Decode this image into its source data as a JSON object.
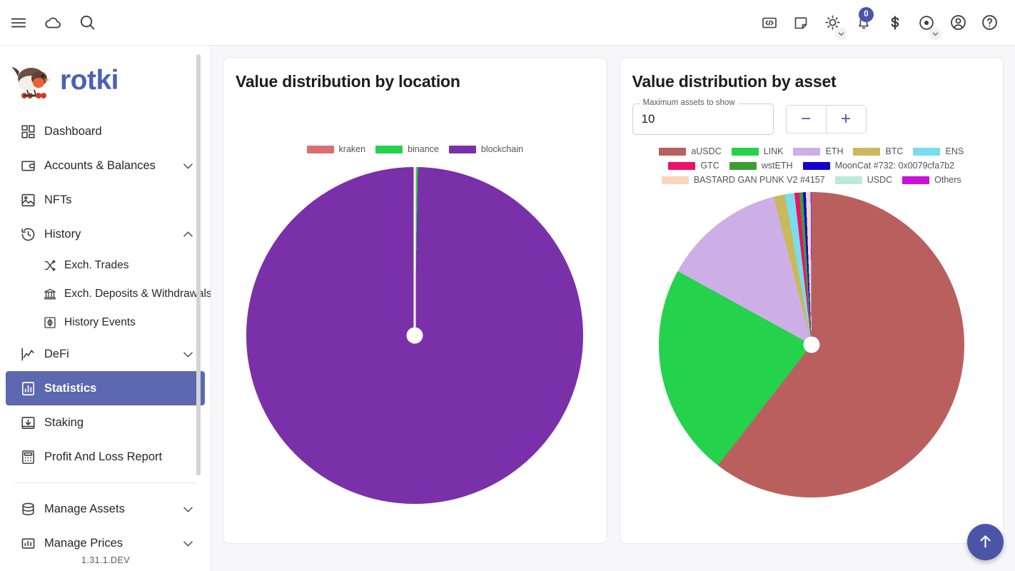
{
  "app": {
    "brand_name": "rotki",
    "version": "1.31.1.DEV"
  },
  "topbar": {
    "left_icons": [
      {
        "name": "menu-icon",
        "label": "Menu"
      },
      {
        "name": "cloud-icon",
        "label": "Backup"
      },
      {
        "name": "search-icon",
        "label": "Search"
      }
    ],
    "right_icons": [
      {
        "name": "code-icon",
        "label": "Developer"
      },
      {
        "name": "note-icon",
        "label": "Notes"
      },
      {
        "name": "sun-icon",
        "label": "Theme"
      },
      {
        "name": "bell-icon",
        "label": "Notifications"
      },
      {
        "name": "dollar-icon",
        "label": "Currency"
      },
      {
        "name": "eye-icon",
        "label": "Privacy mode"
      },
      {
        "name": "account-circle-icon",
        "label": "Account"
      },
      {
        "name": "help-circle-icon",
        "label": "Help"
      }
    ],
    "notification_count": "0"
  },
  "sidebar": {
    "items": [
      {
        "label": "Dashboard",
        "icon": "dashboard-icon",
        "expandable": false,
        "active": false
      },
      {
        "label": "Accounts & Balances",
        "icon": "wallet-icon",
        "expandable": true,
        "expanded": false,
        "active": false
      },
      {
        "label": "NFTs",
        "icon": "image-icon",
        "expandable": false,
        "active": false
      },
      {
        "label": "History",
        "icon": "history-icon",
        "expandable": true,
        "expanded": true,
        "active": false
      },
      {
        "label": "DeFi",
        "icon": "line-chart-icon",
        "expandable": true,
        "expanded": false,
        "active": false
      },
      {
        "label": "Statistics",
        "icon": "bar-chart-doc-icon",
        "expandable": false,
        "active": true
      },
      {
        "label": "Staking",
        "icon": "inbox-down-icon",
        "expandable": false,
        "active": false
      },
      {
        "label": "Profit And Loss Report",
        "icon": "calculator-icon",
        "expandable": false,
        "active": false
      },
      {
        "label": "Manage Assets",
        "icon": "database-icon",
        "expandable": true,
        "expanded": false,
        "active": false
      },
      {
        "label": "Manage Prices",
        "icon": "price-tag-chart-icon",
        "expandable": true,
        "expanded": false,
        "active": false
      }
    ],
    "history_subitems": [
      {
        "label": "Exch. Trades",
        "icon": "shuffle-icon"
      },
      {
        "label": "Exch. Deposits & Withdrawals",
        "icon": "bank-icon"
      },
      {
        "label": "History Events",
        "icon": "swap-vertical-icon"
      }
    ]
  },
  "chart_data": [
    {
      "type": "pie",
      "title": "Value distribution by location",
      "categories": [
        "kraken",
        "binance",
        "blockchain"
      ],
      "values": [
        0.15,
        0.15,
        99.7
      ],
      "colors": [
        "#d9706f",
        "#24d24c",
        "#7a30a8"
      ],
      "legend_position": "top",
      "unit": "percent"
    },
    {
      "type": "pie",
      "title": "Value distribution by asset",
      "categories": [
        "aUSDC",
        "LINK",
        "ETH",
        "BTC",
        "ENS",
        "GTC",
        "wstETH",
        "MoonCat #732: 0x0079cfa7b2",
        "BASTARD GAN PUNK V2 #4157",
        "USDC",
        "Others"
      ],
      "values": [
        60.5,
        22.5,
        13.0,
        1.2,
        1.0,
        0.5,
        0.4,
        0.3,
        0.3,
        0.2,
        0.1
      ],
      "colors": [
        "#b9605f",
        "#24d24c",
        "#ceaee6",
        "#c9b95c",
        "#79dcf0",
        "#ee1169",
        "#3f9c35",
        "#1200cc",
        "#fbd6bd",
        "#bbeadb",
        "#c910d6"
      ],
      "legend_position": "top",
      "unit": "percent"
    }
  ],
  "cards": {
    "location": {
      "title": "Value distribution by location"
    },
    "asset": {
      "title": "Value distribution by asset",
      "max_assets_label": "Maximum assets to show",
      "max_assets_value": "10",
      "decrement_label": "−",
      "increment_label": "+"
    }
  },
  "fab": {
    "name": "scroll-to-top",
    "label": "↑"
  },
  "colors": {
    "accent": "#4a55a6",
    "active_nav": "#5c68b0",
    "brand_text": "#4a62b5",
    "page_bg": "#f7f7f9"
  }
}
